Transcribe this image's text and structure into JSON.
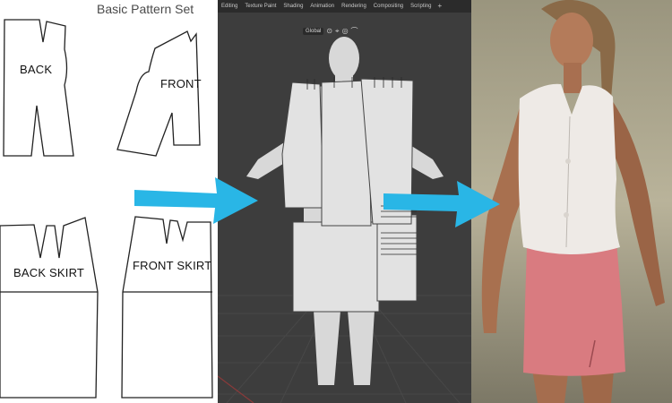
{
  "pattern_panel": {
    "title": "Basic Pattern Set",
    "pieces": [
      {
        "label": "BACK"
      },
      {
        "label": "FRONT"
      },
      {
        "label": "BACK SKIRT"
      },
      {
        "label": "FRONT SKIRT"
      }
    ]
  },
  "viewport": {
    "tabs": [
      "Editing",
      "Texture Paint",
      "Shading",
      "Animation",
      "Rendering",
      "Compositing",
      "Scripting"
    ],
    "add_tab": "+",
    "orientation": "Global",
    "icons": [
      "pivot-icon",
      "snap-icon",
      "proportional-editing-icon",
      "falloff-icon"
    ]
  },
  "colors": {
    "arrow": "#29b6e6",
    "viewport_bg": "#3d3d3d",
    "shirt": "#eeeae6",
    "skirt": "#d97b80"
  }
}
